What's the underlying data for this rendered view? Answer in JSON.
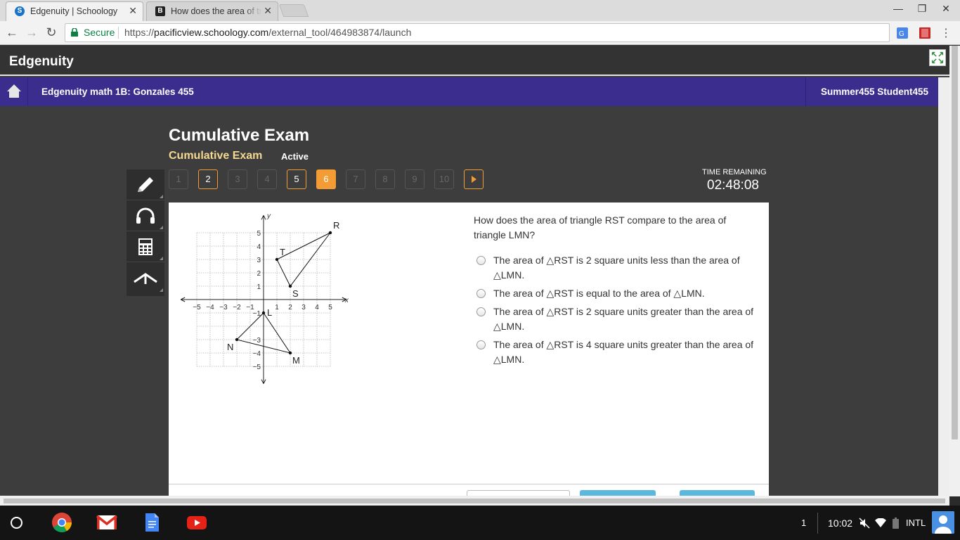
{
  "browser": {
    "tabs": [
      {
        "title": "Edgenuity | Schoology",
        "favicon": "schoology-s-icon"
      },
      {
        "title": "How does the area of triangle RST",
        "favicon": "brainly-b-icon"
      }
    ],
    "secure_label": "Secure",
    "url_scheme": "https://",
    "url_host": "pacificview.schoology.com",
    "url_path": "/external_tool/464983874/launch"
  },
  "header": {
    "brand": "Edgenuity",
    "course": "Edgenuity math 1B: Gonzales 455",
    "user": "Summer455 Student455"
  },
  "exam": {
    "title": "Cumulative Exam",
    "subtitle": "Cumulative Exam",
    "status": "Active",
    "questions": [
      {
        "n": "1",
        "state": "unanswered"
      },
      {
        "n": "2",
        "state": "answered"
      },
      {
        "n": "3",
        "state": "unanswered"
      },
      {
        "n": "4",
        "state": "unanswered"
      },
      {
        "n": "5",
        "state": "answered"
      },
      {
        "n": "6",
        "state": "current"
      },
      {
        "n": "7",
        "state": "unanswered"
      },
      {
        "n": "8",
        "state": "unanswered"
      },
      {
        "n": "9",
        "state": "unanswered"
      },
      {
        "n": "10",
        "state": "unanswered"
      }
    ],
    "time_label": "TIME REMAINING",
    "time_value": "02:48:08"
  },
  "tools": [
    "pencil-icon",
    "headphones-icon",
    "calculator-icon",
    "reference-icon"
  ],
  "question": {
    "prompt": "How does the area of triangle RST compare to the area of triangle LMN?",
    "options": [
      "The area of △RST is 2 square units less than the area of △LMN.",
      "The area of △RST is equal to the area of △LMN.",
      "The area of △RST is 2 square units greater than the area of △LMN.",
      "The area of △RST is 4 square units greater than the area of △LMN."
    ]
  },
  "graph": {
    "x_axis_label": "x",
    "y_axis_label": "y",
    "x_ticks": [
      "−5",
      "−4",
      "−3",
      "−2",
      "−1",
      "1",
      "2",
      "3",
      "4",
      "5"
    ],
    "y_ticks": [
      "5",
      "4",
      "3",
      "2",
      "1",
      "−1",
      "−3",
      "−4",
      "−5"
    ],
    "points": [
      {
        "name": "R",
        "x": 5,
        "y": 5
      },
      {
        "name": "T",
        "x": 1,
        "y": 3
      },
      {
        "name": "S",
        "x": 2,
        "y": 1
      },
      {
        "name": "L",
        "x": 0,
        "y": -1
      },
      {
        "name": "N",
        "x": -2,
        "y": -3
      },
      {
        "name": "M",
        "x": 2,
        "y": -4
      }
    ],
    "triangles": [
      [
        "R",
        "T",
        "S"
      ],
      [
        "L",
        "N",
        "M"
      ]
    ]
  },
  "taskbar": {
    "apps": [
      "chrome-icon",
      "gmail-icon",
      "docs-icon",
      "youtube-icon"
    ],
    "notification_count": "1",
    "clock": "10:02",
    "ime": "INTL"
  },
  "colors": {
    "course_bar": "#3b2d8e",
    "accent_orange": "#f39c33",
    "subtitle_gold": "#f3d991",
    "secure_green": "#0b8043"
  }
}
